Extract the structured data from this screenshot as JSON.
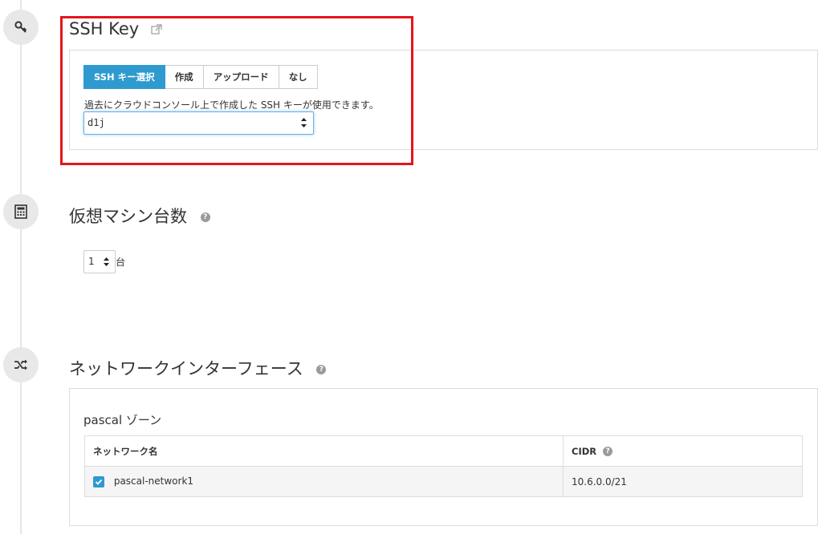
{
  "ssh_section": {
    "title": "SSH Key",
    "tabs": [
      "SSH キー選択",
      "作成",
      "アップロード",
      "なし"
    ],
    "active_tab": "SSH キー選択",
    "hint": "過去にクラウドコンソール上で作成した SSH キーが使用できます。",
    "selected_key": "d1j"
  },
  "vm_section": {
    "title": "仮想マシン台数",
    "count": "1",
    "unit": "台"
  },
  "network_section": {
    "title": "ネットワークインターフェース",
    "zone_title": "pascal ゾーン",
    "columns": [
      "ネットワーク名",
      "CIDR"
    ],
    "rows": [
      {
        "checked": true,
        "name": "pascal-network1",
        "cidr": "10.6.0.0/21"
      }
    ]
  },
  "icons": [
    "key-icon",
    "calculator-icon",
    "shuffle-icon",
    "external-link-icon",
    "help-icon",
    "checkbox-icon"
  ],
  "colors": {
    "accent": "#2e9ad0",
    "highlight": "#e4161b"
  }
}
